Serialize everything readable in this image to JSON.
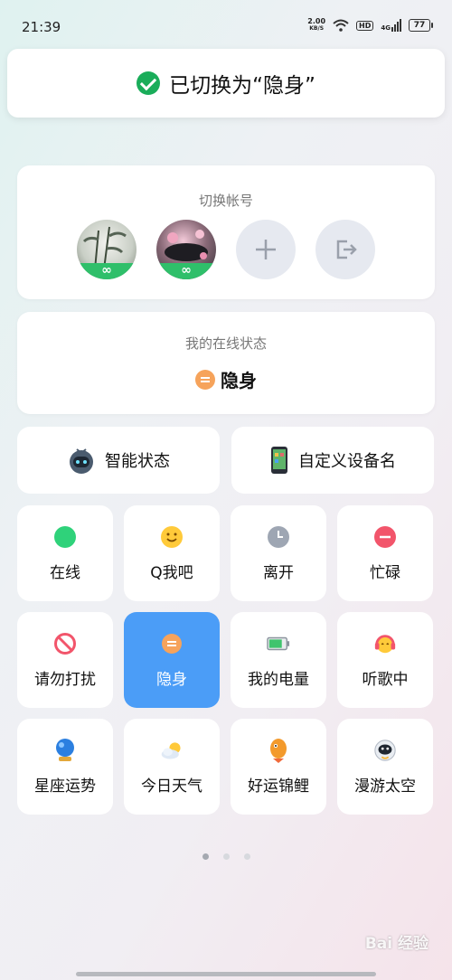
{
  "status_bar": {
    "time": "21:39",
    "speed_value": "2.00",
    "speed_unit": "KB/S",
    "hd": "HD",
    "network": "4G",
    "battery": "77"
  },
  "toast": {
    "text": "已切换为“隐身”"
  },
  "accounts": {
    "title": "切换帐号",
    "badge_symbol": "∞"
  },
  "online_status": {
    "title": "我的在线状态",
    "current": "隐身"
  },
  "quick": {
    "smart_status": "智能状态",
    "custom_device": "自定义设备名"
  },
  "status_tiles": [
    {
      "label": "在线",
      "icon": "green-dot-icon"
    },
    {
      "label": "Q我吧",
      "icon": "smile-face-icon"
    },
    {
      "label": "离开",
      "icon": "clock-icon"
    },
    {
      "label": "忙碌",
      "icon": "minus-circle-icon"
    },
    {
      "label": "请勿打扰",
      "icon": "no-entry-icon"
    },
    {
      "label": "隐身",
      "icon": "invisible-icon",
      "selected": true
    },
    {
      "label": "我的电量",
      "icon": "battery-icon"
    },
    {
      "label": "听歌中",
      "icon": "headphones-icon"
    },
    {
      "label": "星座运势",
      "icon": "crystal-ball-icon"
    },
    {
      "label": "今日天气",
      "icon": "weather-icon"
    },
    {
      "label": "好运锦鲤",
      "icon": "koi-icon"
    },
    {
      "label": "漫游太空",
      "icon": "astronaut-icon"
    }
  ],
  "pager": {
    "pages": 3,
    "current": 1
  },
  "watermark": "Bai 经验",
  "colors": {
    "selected": "#4b9df7",
    "success": "#1aad5a",
    "badge": "#2fbf6a"
  }
}
